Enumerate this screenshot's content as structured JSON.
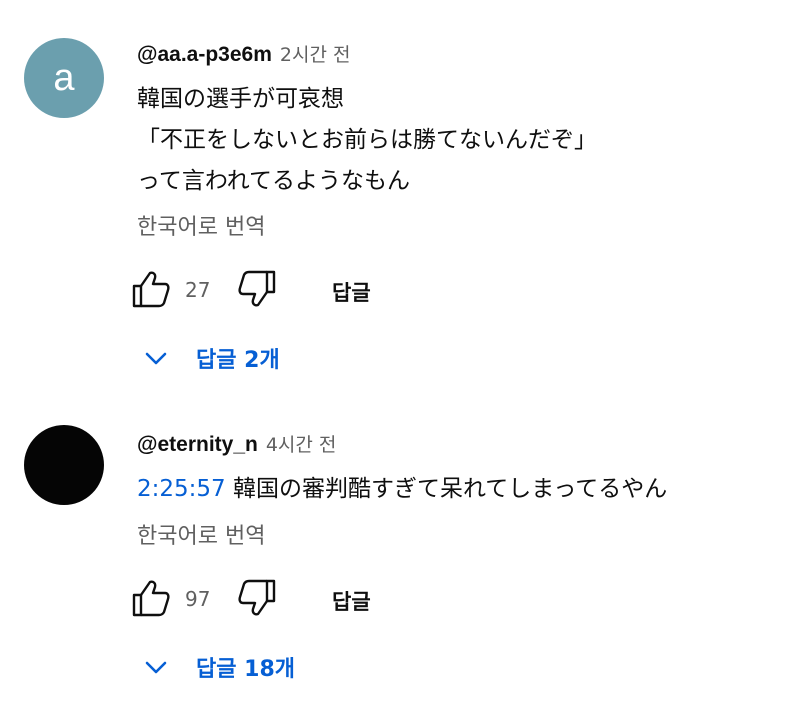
{
  "colors": {
    "avatar_1": "#6b9fae",
    "avatar_2": "#050505",
    "link_blue": "#065fd4",
    "secondary_text": "#606060"
  },
  "comments": [
    {
      "avatar_letter": "a",
      "author": "@aa.a-p3e6m",
      "time": "2시간 전",
      "body_lines": [
        "韓国の選手が可哀想",
        "「不正をしないとお前らは勝てないんだぞ」",
        "って言われてるようなもん"
      ],
      "translate_label": "한국어로 번역",
      "like_count": "27",
      "reply_label": "답글",
      "replies_label": "답글 2개"
    },
    {
      "avatar_letter": "",
      "author": "@eternity_n",
      "time": "4시간 전",
      "timestamp_link": "2:25:57",
      "body_text": " 韓国の審判酷すぎて呆れてしまってるやん",
      "translate_label": "한국어로 번역",
      "like_count": "97",
      "reply_label": "답글",
      "replies_label": "답글 18개"
    }
  ],
  "icons": {
    "like": "thumb-up-icon",
    "dislike": "thumb-down-icon",
    "expand": "chevron-down-icon"
  }
}
